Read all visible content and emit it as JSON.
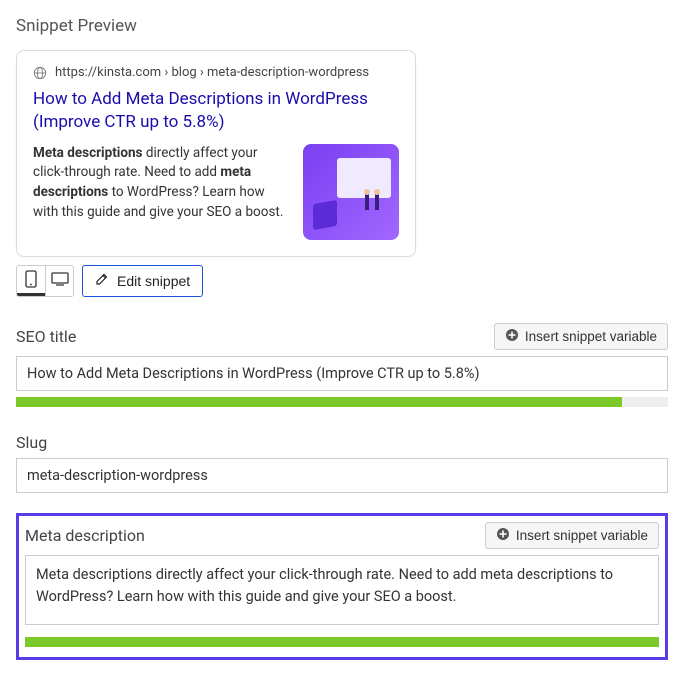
{
  "preview": {
    "heading": "Snippet Preview",
    "url": "https://kinsta.com › blog › meta-description-wordpress",
    "title": "How to Add Meta Descriptions in WordPress (Improve CTR up to 5.8%)",
    "desc_parts": {
      "b1": "Meta descriptions",
      "t1": " directly affect your click-through rate. Need to add ",
      "b2": "meta descriptions",
      "t2": " to WordPress? Learn how with this guide and give your SEO a boost."
    }
  },
  "toolbar": {
    "edit_label": "Edit snippet"
  },
  "seo_title": {
    "label": "SEO title",
    "insert_label": "Insert snippet variable",
    "value": "How to Add Meta Descriptions in WordPress (Improve CTR up to 5.8%)",
    "progress_percent": 93
  },
  "slug": {
    "label": "Slug",
    "value": "meta-description-wordpress"
  },
  "meta_description": {
    "label": "Meta description",
    "insert_label": "Insert snippet variable",
    "value": "Meta descriptions directly affect your click-through rate. Need to add meta descriptions to WordPress? Learn how with this guide and give your SEO a boost.",
    "progress_percent": 100
  },
  "colors": {
    "link": "#1a0dab",
    "progress": "#7cc92a",
    "highlight_border": "#5b3be8"
  }
}
